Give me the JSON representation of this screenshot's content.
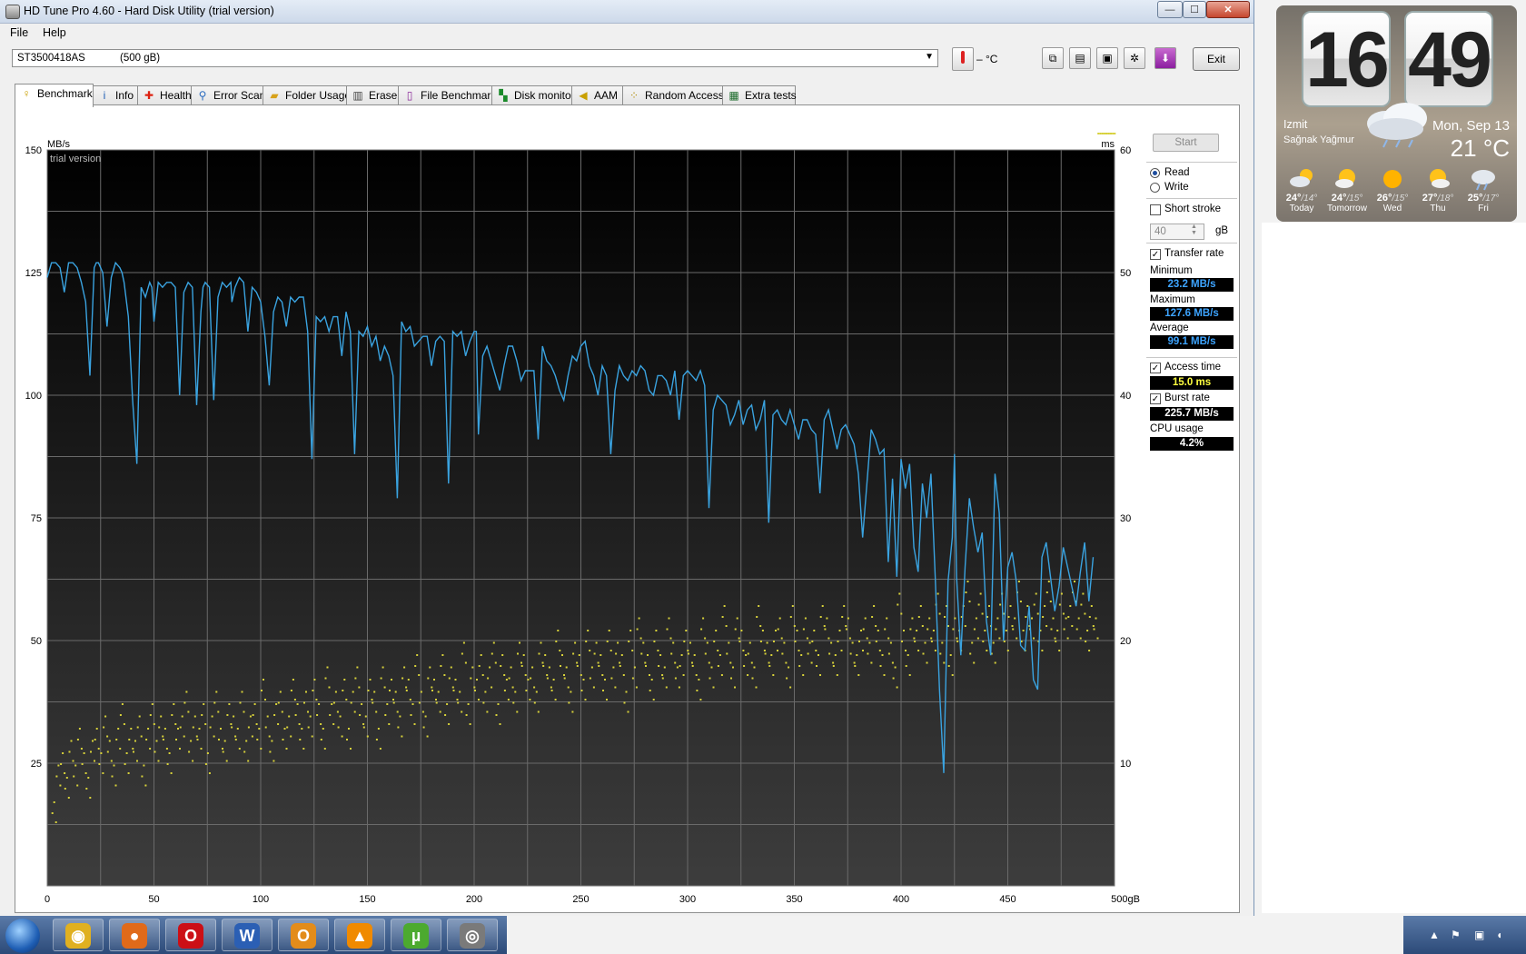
{
  "window": {
    "title": "HD Tune Pro 4.60 - Hard Disk Utility (trial version)"
  },
  "titlebar_buttons": {
    "minimize": "—",
    "maximize": "☐",
    "close": "✕"
  },
  "menu": [
    "File",
    "Help"
  ],
  "drive": {
    "name": "ST3500418AS",
    "size": "(500 gB)",
    "temperature": "– °C"
  },
  "toolbar": {
    "exit_label": "Exit"
  },
  "tabs": [
    "Benchmark",
    "Info",
    "Health",
    "Error Scan",
    "Folder Usage",
    "Erase",
    "File Benchmark",
    "Disk monitor",
    "AAM",
    "Random Access",
    "Extra tests"
  ],
  "benchmark": {
    "start_label": "Start",
    "read_label": "Read",
    "write_label": "Write",
    "mode_selected": "Read",
    "short_stroke_label": "Short stroke",
    "short_stroke_checked": false,
    "short_stroke_value": "40",
    "short_stroke_unit": "gB",
    "transfer_rate_label": "Transfer rate",
    "transfer_rate_checked": true,
    "minimum_label": "Minimum",
    "minimum_value": "23.2 MB/s",
    "maximum_label": "Maximum",
    "maximum_value": "127.6 MB/s",
    "average_label": "Average",
    "average_value": "99.1 MB/s",
    "access_time_label": "Access time",
    "access_time_checked": true,
    "access_time_value": "15.0 ms",
    "burst_rate_label": "Burst rate",
    "burst_rate_checked": true,
    "burst_rate_value": "225.7 MB/s",
    "cpu_usage_label": "CPU usage",
    "cpu_usage_value": "4.2%"
  },
  "colors": {
    "transfer_line": "#3aa3e0",
    "access_dots": "#d7d13a",
    "value_blue": "#3da4ff",
    "value_yellow": "#ffff40",
    "value_white": "#ffffff"
  },
  "chart_data": {
    "type": "line",
    "watermark": "trial version",
    "left_axis": {
      "label": "MB/s",
      "range": [
        0,
        150
      ],
      "ticks": [
        "150",
        "125",
        "100",
        "75",
        "50",
        "25"
      ]
    },
    "right_axis": {
      "label": "ms",
      "range": [
        0,
        60
      ],
      "ticks": [
        "60",
        "50",
        "40",
        "30",
        "20",
        "10"
      ]
    },
    "x_axis": {
      "range": [
        0,
        500
      ],
      "ticks": [
        "0",
        "50",
        "100",
        "150",
        "200",
        "250",
        "300",
        "350",
        "400",
        "450",
        "500gB"
      ]
    },
    "grid": true,
    "transfer_rate": {
      "x": [
        0,
        2,
        4,
        6,
        8,
        10,
        12,
        14,
        16,
        18,
        20,
        22,
        23,
        24,
        26,
        28,
        30,
        32,
        34,
        35,
        36,
        38,
        40,
        42,
        44,
        46,
        48,
        49,
        50,
        52,
        54,
        56,
        58,
        60,
        62,
        64,
        66,
        68,
        70,
        72,
        73,
        74,
        76,
        78,
        80,
        82,
        84,
        86,
        86.5,
        88,
        90,
        92,
        94,
        96,
        98,
        100,
        102,
        104,
        106,
        108,
        110,
        112,
        114,
        116,
        118,
        120,
        122,
        124,
        126,
        128,
        130,
        132,
        134,
        136,
        138,
        140,
        142,
        144,
        146,
        148,
        150,
        152,
        154,
        156,
        158,
        160,
        162,
        164,
        166,
        168,
        170,
        172,
        174,
        176,
        178,
        180,
        182,
        184,
        186,
        188,
        190,
        192,
        194,
        196,
        198,
        200,
        201,
        202,
        204,
        206,
        208,
        210,
        212,
        214,
        216,
        218,
        220,
        222,
        224,
        226,
        228,
        230,
        232,
        234,
        236,
        238,
        240,
        242,
        244,
        246,
        248,
        250,
        252,
        254,
        256,
        258,
        260,
        262,
        264,
        266,
        268,
        270,
        272,
        274,
        276,
        278,
        280,
        282,
        284,
        286,
        288,
        290,
        292,
        294,
        296,
        298,
        300,
        302,
        304,
        306,
        308,
        310,
        312,
        314,
        316,
        318,
        320,
        322,
        324,
        326,
        328,
        330,
        332,
        334,
        336,
        338,
        340,
        342,
        344,
        346,
        348,
        350,
        352,
        354,
        356,
        358,
        360,
        362,
        364,
        366,
        368,
        370,
        372,
        374,
        376,
        378,
        380,
        382,
        384,
        386,
        388,
        390,
        392,
        394,
        396,
        398,
        400,
        402,
        404,
        406,
        408,
        410,
        412,
        414,
        416,
        418,
        420,
        422,
        424,
        425,
        426,
        428,
        430,
        432,
        434,
        436,
        438,
        440,
        442,
        444,
        446,
        448,
        450,
        452,
        454,
        456,
        458,
        460,
        462,
        464,
        466,
        468,
        470,
        472,
        474,
        476,
        478,
        480,
        482,
        484,
        486,
        488,
        490,
        492,
        494,
        496,
        498,
        500
      ],
      "values": [
        124,
        127,
        127,
        126,
        121,
        127,
        127,
        126,
        123,
        119,
        104,
        126,
        127,
        127,
        125,
        114,
        124,
        127,
        126,
        125,
        123,
        116,
        99,
        86,
        122,
        120,
        123,
        122,
        115,
        123,
        122,
        123,
        123,
        122,
        100,
        121,
        123,
        122,
        98,
        117,
        122,
        123,
        122,
        99,
        120,
        123,
        122,
        123,
        119,
        122,
        124,
        123,
        113,
        122,
        121,
        119,
        112,
        102,
        117,
        120,
        119,
        114,
        120,
        119,
        120,
        120,
        113,
        87,
        116,
        115,
        116,
        113,
        116,
        116,
        108,
        117,
        113,
        88,
        113,
        112,
        114,
        110,
        112,
        107,
        110,
        108,
        104,
        79,
        115,
        113,
        114,
        110,
        111,
        112,
        112,
        106,
        111,
        112,
        111,
        82,
        113,
        112,
        113,
        108,
        111,
        113,
        113,
        92,
        108,
        110,
        107,
        104,
        101,
        106,
        110,
        110,
        107,
        103,
        105,
        105,
        105,
        91,
        110,
        107,
        106,
        104,
        101,
        99,
        104,
        108,
        107,
        110,
        111,
        106,
        104,
        100,
        106,
        104,
        88,
        101,
        106,
        104,
        103,
        105,
        104,
        106,
        105,
        101,
        100,
        104,
        104,
        103,
        100,
        105,
        95,
        104,
        105,
        104,
        103,
        105,
        102,
        77,
        97,
        100,
        99,
        98,
        94,
        96,
        99,
        94,
        97,
        98,
        93,
        95,
        99,
        74,
        96,
        97,
        95,
        94,
        97,
        94,
        91,
        95,
        95,
        93,
        92,
        80,
        95,
        97,
        93,
        89,
        93,
        94,
        92,
        90,
        84,
        71,
        82,
        93,
        91,
        88,
        89,
        66,
        83,
        63,
        87,
        81,
        86,
        69,
        64,
        82,
        75,
        84,
        63,
        40,
        23,
        62,
        71,
        88,
        63,
        47,
        65,
        79,
        73,
        68,
        72,
        54,
        47,
        84,
        76,
        50,
        65,
        68,
        62,
        49,
        48,
        57,
        42,
        40,
        67,
        70,
        63,
        56,
        61,
        69,
        65,
        61,
        57,
        64,
        70,
        58,
        67
      ]
    },
    "access_time_ms": {
      "x": [
        2,
        4,
        6,
        8,
        10,
        12,
        14,
        16,
        18,
        20,
        22,
        24,
        26,
        28,
        30,
        32,
        34,
        36,
        38,
        40,
        42,
        44,
        46,
        48,
        50,
        52,
        54,
        56,
        58,
        60,
        62,
        64,
        66,
        68,
        70,
        72,
        74,
        76,
        78,
        80,
        82,
        84,
        86,
        88,
        90,
        92,
        94,
        96,
        98,
        100,
        102,
        104,
        106,
        108,
        110,
        112,
        114,
        116,
        118,
        120,
        122,
        124,
        126,
        128,
        130,
        132,
        134,
        136,
        138,
        140,
        142,
        144,
        146,
        148,
        150,
        152,
        154,
        156,
        158,
        160,
        162,
        164,
        166,
        168,
        170,
        172,
        174,
        176,
        178,
        180,
        182,
        184,
        186,
        188,
        190,
        192,
        194,
        196,
        198,
        200,
        202,
        204,
        206,
        208,
        210,
        212,
        214,
        216,
        218,
        220,
        222,
        224,
        226,
        228,
        230,
        232,
        234,
        236,
        238,
        240,
        242,
        244,
        246,
        248,
        250,
        252,
        254,
        256,
        258,
        260,
        262,
        264,
        266,
        268,
        270,
        272,
        274,
        276,
        278,
        280,
        282,
        284,
        286,
        288,
        290,
        292,
        294,
        296,
        298,
        300,
        302,
        304,
        306,
        308,
        310,
        312,
        314,
        316,
        318,
        320,
        322,
        324,
        326,
        328,
        330,
        332,
        334,
        336,
        338,
        340,
        342,
        344,
        346,
        348,
        350,
        352,
        354,
        356,
        358,
        360,
        362,
        364,
        366,
        368,
        370,
        372,
        374,
        376,
        378,
        380,
        382,
        384,
        386,
        388,
        390,
        392,
        394,
        396,
        398,
        400,
        402,
        404,
        406,
        408,
        410,
        412,
        414,
        416,
        418,
        420,
        422,
        424,
        426,
        428,
        430,
        432,
        434,
        436,
        438,
        440,
        442,
        444,
        446,
        448,
        450,
        452,
        454,
        456,
        458,
        460,
        462,
        464,
        466,
        468,
        470,
        472,
        474,
        476,
        478,
        480,
        482,
        484,
        486,
        488,
        490,
        492,
        494,
        496,
        498
      ],
      "values": [
        6,
        9,
        10,
        8,
        11,
        9,
        12,
        10,
        8,
        11,
        12,
        10,
        13,
        11,
        9,
        12,
        14,
        10,
        12,
        11,
        13,
        9,
        12,
        14,
        11,
        13,
        12,
        10,
        14,
        12,
        13,
        15,
        11,
        13,
        12,
        14,
        10,
        13,
        15,
        12,
        11,
        14,
        13,
        12,
        15,
        11,
        13,
        14,
        12,
        16,
        13,
        11,
        14,
        15,
        12,
        13,
        16,
        14,
        12,
        15,
        13,
        16,
        14,
        12,
        17,
        14,
        15,
        13,
        16,
        12,
        15,
        17,
        14,
        13,
        16,
        15,
        12,
        17,
        14,
        16,
        15,
        13,
        17,
        16,
        14,
        18,
        15,
        13,
        17,
        16,
        15,
        18,
        14,
        17,
        16,
        15,
        19,
        14,
        17,
        16,
        18,
        15,
        17,
        19,
        14,
        18,
        16,
        17,
        15,
        19,
        18,
        16,
        17,
        15,
        19,
        18,
        17,
        16,
        20,
        18,
        17,
        15,
        19,
        18,
        16,
        20,
        17,
        19,
        18,
        16,
        20,
        17,
        19,
        18,
        15,
        20,
        17,
        21,
        19,
        18,
        16,
        20,
        18,
        17,
        21,
        19,
        17,
        18,
        20,
        19,
        18,
        16,
        21,
        19,
        17,
        20,
        18,
        22,
        19,
        17,
        21,
        20,
        18,
        19,
        17,
        22,
        20,
        19,
        18,
        20,
        21,
        19,
        17,
        22,
        20,
        18,
        21,
        19,
        20,
        18,
        22,
        21,
        19,
        18,
        20,
        22,
        21,
        19,
        18,
        20,
        21,
        19,
        22,
        20,
        18,
        21,
        19,
        17,
        23,
        20,
        18,
        21,
        20,
        22,
        19,
        21,
        20,
        23,
        19,
        22,
        18,
        21,
        20,
        22,
        24,
        19,
        21,
        23,
        20,
        22,
        19,
        21,
        23,
        20,
        22,
        21,
        24,
        20,
        22,
        21,
        23,
        20,
        22,
        24,
        21,
        20,
        23,
        21,
        22,
        24,
        21,
        23,
        20,
        22,
        21
      ]
    }
  },
  "gadget": {
    "hour": "16",
    "minute": "49",
    "city": "Izmit",
    "condition": "Sağnak Yağmur",
    "date": "Mon, Sep 13",
    "temperature": "21 °C",
    "forecast": [
      {
        "high": "24°",
        "low": "/14°",
        "day": "Today"
      },
      {
        "high": "24°",
        "low": "/15°",
        "day": "Tomorrow"
      },
      {
        "high": "26°",
        "low": "/15°",
        "day": "Wed"
      },
      {
        "high": "27°",
        "low": "/18°",
        "day": "Thu"
      },
      {
        "high": "25°",
        "low": "/17°",
        "day": "Fri"
      }
    ]
  },
  "taskbar": {
    "apps": [
      {
        "name": "chrome",
        "glyph": "◉",
        "color": "#e0b020"
      },
      {
        "name": "firefox",
        "glyph": "●",
        "color": "#e06a1a"
      },
      {
        "name": "opera",
        "glyph": "O",
        "color": "#cc0f16"
      },
      {
        "name": "word",
        "glyph": "W",
        "color": "#2b5fb4"
      },
      {
        "name": "outlook",
        "glyph": "O",
        "color": "#e38c1a"
      },
      {
        "name": "vlc",
        "glyph": "▲",
        "color": "#f08a00"
      },
      {
        "name": "utorrent",
        "glyph": "µ",
        "color": "#4caa2f"
      },
      {
        "name": "hdtune",
        "glyph": "◎",
        "color": "#7a7a7a"
      }
    ],
    "tray": {
      "chevron": "▲",
      "flag": "⚑",
      "network": "▣",
      "volume": "◖"
    }
  }
}
